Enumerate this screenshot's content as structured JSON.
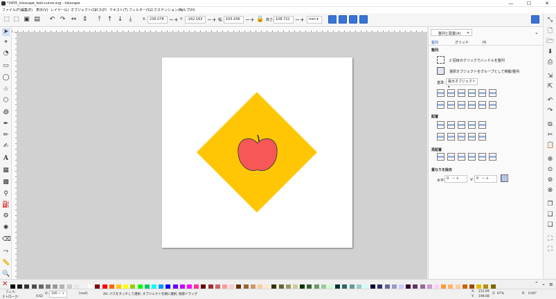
{
  "window": {
    "title": "*2455_inkscape_text-curve.svg - Inkscape",
    "minimize": "—",
    "maximize": "☐",
    "close": "✕"
  },
  "menu": [
    "ファイル(F)",
    "編集(E)",
    "表示(V)",
    "レイヤー(L)",
    "オブジェクト(O)",
    "パス(P)",
    "テキスト(T)",
    "フィルター(S)",
    "エクステンション(N)",
    "ヘルプ(H)"
  ],
  "toolbar": {
    "x_label": "X:",
    "x_value": "236.078",
    "y_label": "Y:",
    "y_value": "-162.163",
    "w_label": "幅:",
    "w_value": "105.436",
    "h_label": "高さ:",
    "h_value": "108.721",
    "unit": "mm"
  },
  "panel": {
    "tab_label": "整列と配置(A)",
    "tab_close": "✕",
    "subtabs": [
      "整列",
      "グリッド",
      "円"
    ],
    "section_align": "整列",
    "opt1": "2 回目のクリックでハンドルを整列",
    "opt2": "選択オブジェクトをグループとして移動/整列",
    "relative_label": "基準:",
    "relative_value": "最大オブジェクト",
    "section_distribute": "配置",
    "section_rearrange": "再配置",
    "section_overlap": "重なりを除去",
    "gap_h_label": "水平:",
    "gap_h_value": "0",
    "gap_v_label": "V:",
    "gap_v_value": "0"
  },
  "status": {
    "fill_label": "フィル:",
    "stroke_label": "ストローク:",
    "stroke_value": "0.62",
    "opacity_label": "O:",
    "opacity_value": "100",
    "layer": "[root]",
    "message": "Alt: パスをタッチして選択, オブジェクトを順に選択, 随意ドラッグ",
    "x_label": "X:",
    "x_value": "212.69",
    "y_label": "Y:",
    "y_value": "198.68",
    "zoom_label": "Z:",
    "zoom_value": "67%",
    "rot_label": "R:",
    "rot_value": "0.00°"
  },
  "colors": {
    "diamond": "#fec604",
    "apple": "#f75757",
    "accent": "#3874d8"
  },
  "palette": [
    "#000000",
    "#1a1a1a",
    "#333333",
    "#4d4d4d",
    "#666666",
    "#808080",
    "#999999",
    "#b3b3b3",
    "#cccccc",
    "#e6e6e6",
    "#f2f2f2",
    "#ffffff",
    "#800000",
    "#ff0000",
    "#ff6600",
    "#ffcc00",
    "#ffff00",
    "#99cc00",
    "#00ff00",
    "#00cc66",
    "#00ffff",
    "#0099ff",
    "#0000ff",
    "#6600ff",
    "#cc00ff",
    "#ff00ff",
    "#ff3399",
    "#660000",
    "#993333",
    "#cc6666",
    "#ff9999",
    "#ffcccc",
    "#663300",
    "#996633",
    "#cc9966",
    "#ffcc99",
    "#ffe6cc",
    "#333300",
    "#666633",
    "#999966",
    "#cccc99",
    "#003300",
    "#336633",
    "#669966",
    "#99cc99",
    "#ccffcc",
    "#003333",
    "#336666",
    "#669999",
    "#99cccc",
    "#ccffff",
    "#000033",
    "#333366",
    "#666699",
    "#9999cc",
    "#ccccff",
    "#330033",
    "#663366",
    "#996699",
    "#cc99cc",
    "#ffccff",
    "#ff9933",
    "#ffb366",
    "#ffcc99",
    "#cc6600",
    "#994c00",
    "#e6b800",
    "#b38f00",
    "#806600"
  ]
}
